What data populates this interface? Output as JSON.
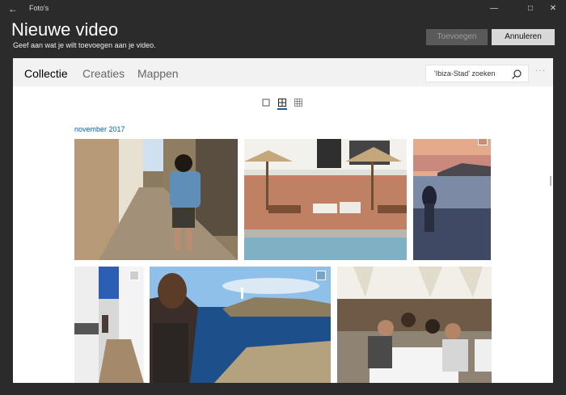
{
  "window": {
    "app_title": "Foto's",
    "back_icon": "back-arrow-icon",
    "controls": [
      "minimize-icon",
      "maximize-icon",
      "close-icon"
    ]
  },
  "header": {
    "title": "Nieuwe video",
    "subtitle": "Geef aan wat je wilt toevoegen aan je video.",
    "add_label": "Toevoegen",
    "cancel_label": "Annuleren"
  },
  "nav": {
    "tabs": [
      {
        "label": "Collectie",
        "active": true
      },
      {
        "label": "Creaties",
        "active": false
      },
      {
        "label": "Mappen",
        "active": false
      }
    ]
  },
  "search": {
    "text": "'Ibiza-Stad' zoeken",
    "icon": "search-icon"
  },
  "view": {
    "modes": [
      "large-view-icon",
      "medium-view-icon",
      "small-view-icon"
    ],
    "selected": "medium-view-icon"
  },
  "gallery": {
    "group_label": "november 2017",
    "photos": [
      {
        "subject": "alley-street-photo"
      },
      {
        "subject": "pool-umbrellas-photo"
      },
      {
        "subject": "sunset-beach-photo"
      },
      {
        "subject": "stairs-street-photo"
      },
      {
        "subject": "sea-coast-photo"
      },
      {
        "subject": "dinner-group-photo"
      }
    ]
  },
  "colors": {
    "accent": "#0063b1",
    "background": "#2b2b2b",
    "panel": "#ffffff"
  }
}
